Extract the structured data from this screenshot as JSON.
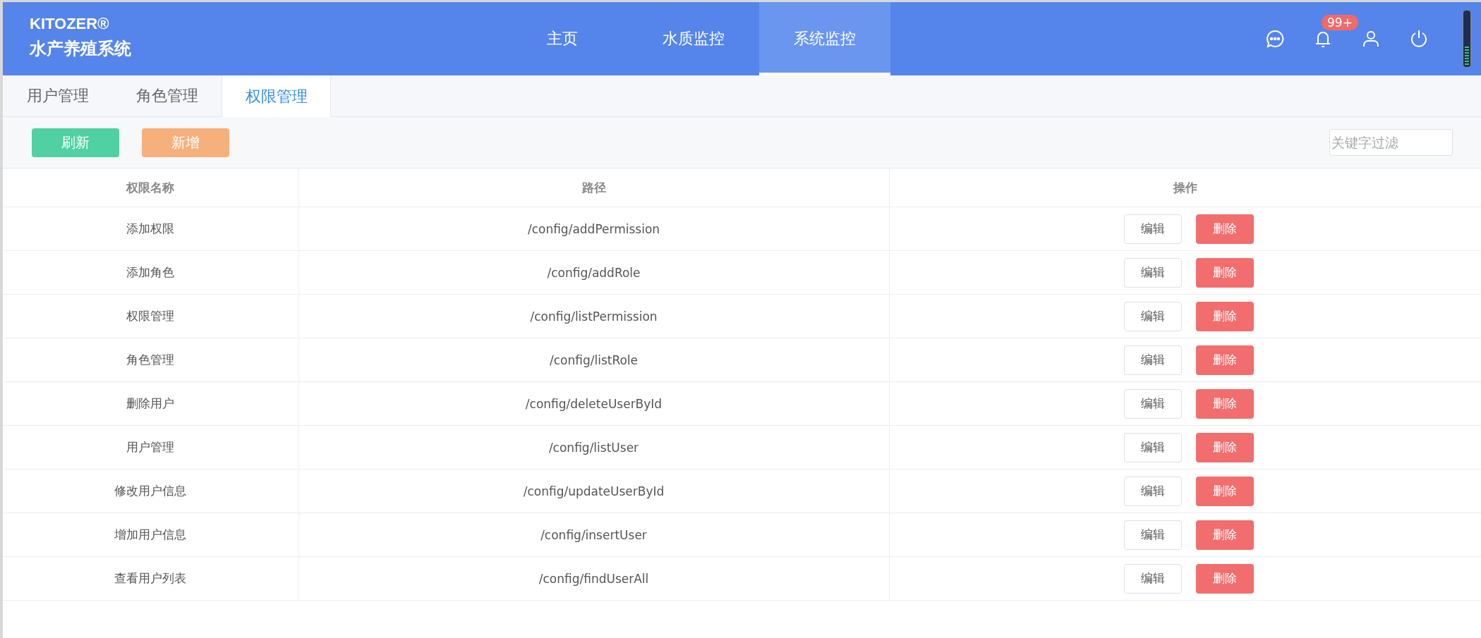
{
  "brand": {
    "name": "KITOZER®",
    "subtitle": "水产养殖系统"
  },
  "nav": [
    {
      "label": "主页",
      "selected": false
    },
    {
      "label": "水质监控",
      "selected": false
    },
    {
      "label": "系统监控",
      "selected": true
    }
  ],
  "notifications": {
    "badge": "99+"
  },
  "tabs": [
    {
      "label": "用户管理",
      "selected": false
    },
    {
      "label": "角色管理",
      "selected": false
    },
    {
      "label": "权限管理",
      "selected": true
    }
  ],
  "toolbar": {
    "refresh": "刷新",
    "add": "新增",
    "search": {
      "placeholder": "关键字过滤"
    }
  },
  "table": {
    "columns": [
      "权限名称",
      "路径",
      "操作"
    ],
    "rows": [
      {
        "name": "添加权限",
        "path": "/config/addPermission",
        "edit": "编辑",
        "delete": "删除"
      },
      {
        "name": "添加角色",
        "path": "/config/addRole",
        "edit": "编辑",
        "delete": "删除"
      },
      {
        "name": "权限管理",
        "path": "/config/listPermission",
        "edit": "编辑",
        "delete": "删除"
      },
      {
        "name": "角色管理",
        "path": "/config/listRole",
        "edit": "编辑",
        "delete": "删除"
      },
      {
        "name": "删除用户",
        "path": "/config/deleteUserById",
        "edit": "编辑",
        "delete": "删除"
      },
      {
        "name": "用户管理",
        "path": "/config/listUser",
        "edit": "编辑",
        "delete": "删除"
      },
      {
        "name": "修改用户信息",
        "path": "/config/updateUserById",
        "edit": "编辑",
        "delete": "删除"
      },
      {
        "name": "增加用户信息",
        "path": "/config/insertUser",
        "edit": "编辑",
        "delete": "删除"
      },
      {
        "name": "查看用户列表",
        "path": "/config/findUserAll",
        "edit": "编辑",
        "delete": "删除"
      }
    ]
  }
}
